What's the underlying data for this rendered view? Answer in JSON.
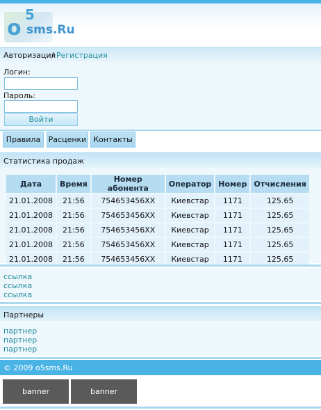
{
  "colors": {
    "accent": "#4ab3e6",
    "link": "#1f8c9b",
    "panel": "#eef7fc",
    "banner": "#5a5a5a"
  },
  "logo": {
    "o": "o",
    "superscript": "5",
    "rest": "sms.Ru"
  },
  "auth": {
    "title": "Авторизация",
    "separator": "/",
    "register_link": "Регистрация"
  },
  "login_form": {
    "login_label": "Логин:",
    "password_label": "Пароль:",
    "login_value": "",
    "password_value": "",
    "submit_label": "Войти"
  },
  "nav": {
    "items": [
      {
        "label": "Правила"
      },
      {
        "label": "Расценки"
      },
      {
        "label": "Контакты"
      }
    ]
  },
  "stats": {
    "title": "Статистика продаж",
    "columns": [
      "Дата",
      "Время",
      "Номер абонента",
      "Оператор",
      "Номер",
      "Отчисления"
    ],
    "rows": [
      [
        "21.01.2008",
        "21:56",
        "754653456XX",
        "Киевстар",
        "1171",
        "125.65"
      ],
      [
        "21.01.2008",
        "21:56",
        "754653456XX",
        "Киевстар",
        "1171",
        "125.65"
      ],
      [
        "21.01.2008",
        "21:56",
        "754653456XX",
        "Киевстар",
        "1171",
        "125.65"
      ],
      [
        "21.01.2008",
        "21:56",
        "754653456XX",
        "Киевстар",
        "1171",
        "125.65"
      ],
      [
        "21.01.2008",
        "21:56",
        "754653456XX",
        "Киевстар",
        "1171",
        "125.65"
      ]
    ]
  },
  "links": [
    "ссылка",
    "ссылка",
    "ссылка"
  ],
  "partners": {
    "title": "Партнеры",
    "items": [
      "партнер",
      "партнер",
      "партнер"
    ]
  },
  "footer": {
    "copyright": "© 2009 o5sms.Ru"
  },
  "banners": [
    "banner",
    "banner"
  ]
}
